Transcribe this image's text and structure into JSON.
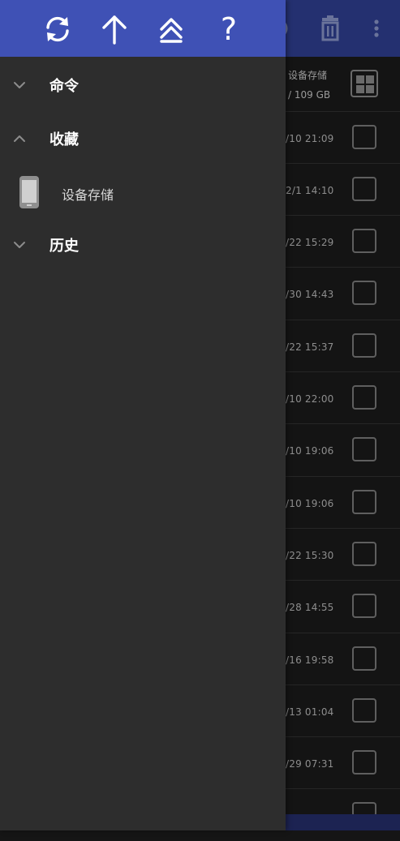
{
  "drawer": {
    "toolbar": {
      "icons": [
        "refresh-icon",
        "arrow-up-icon",
        "double-chevron-up-icon",
        "help-icon"
      ],
      "help_glyph": "?"
    },
    "sections": {
      "commands": {
        "label": "命令",
        "expanded": false
      },
      "favorites": {
        "label": "收藏",
        "expanded": true,
        "items": [
          {
            "label": "设备存储",
            "icon": "phone-icon"
          }
        ]
      },
      "history": {
        "label": "历史",
        "expanded": false
      }
    }
  },
  "background": {
    "toolbar_icons": [
      "delete-icon",
      "more-vert-icon"
    ],
    "storage": {
      "name": "设备存储",
      "size": "/ 109 GB"
    },
    "rows": [
      {
        "date": "/10 21:09"
      },
      {
        "date": "2/1 14:10"
      },
      {
        "date": "/22 15:29"
      },
      {
        "date": "/30 14:43"
      },
      {
        "date": "/22 15:37"
      },
      {
        "date": "/10 22:00"
      },
      {
        "date": "/10 19:06"
      },
      {
        "date": "/10 19:06"
      },
      {
        "date": "/22 15:30"
      },
      {
        "date": "/28 14:55"
      },
      {
        "date": "/16 19:58"
      },
      {
        "date": "/13 01:04"
      },
      {
        "date": "/29 07:31"
      },
      {
        "date": ""
      }
    ]
  },
  "colors": {
    "drawer_toolbar": "#3f51b5",
    "drawer_bg": "#2d2d2d",
    "bg_toolbar_dimmed": "#243070"
  }
}
